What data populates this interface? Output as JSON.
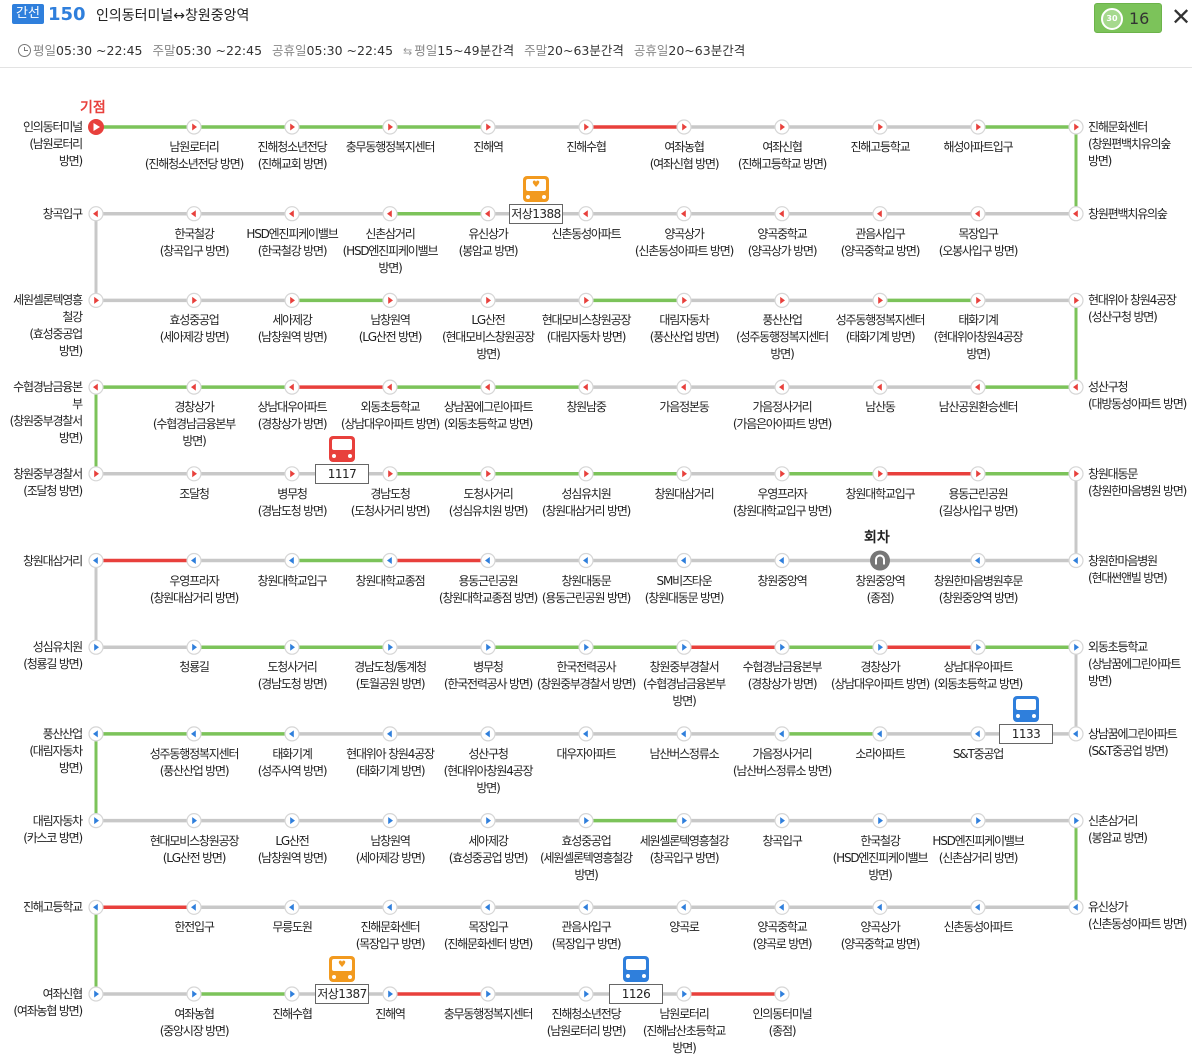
{
  "header": {
    "route_type": "간선",
    "route_number": "150",
    "route_name": "인의동터미널↔창원중앙역",
    "schedule": {
      "weekday_label": "평일",
      "weekday_time": "05:30 ~22:45",
      "weekend_label": "주말",
      "weekend_time": "05:30 ~22:45",
      "holiday_label": "공휴일",
      "holiday_time": "05:30 ~22:45",
      "weekday_interval_label": "평일",
      "weekday_interval": "15~49분간격",
      "weekend_interval_label": "주말",
      "weekend_interval": "20~63분간격",
      "holiday_interval_label": "공휴일",
      "holiday_interval": "20~63분간격"
    },
    "refresh_icon_text": "30",
    "refresh_count": "16",
    "close_icon": "close-icon"
  },
  "markers": {
    "start": "기점",
    "turn": "회차"
  },
  "colors": {
    "green": "#7cc35a",
    "red": "#e8403c",
    "gray": "#c8c8c8",
    "stop_red": "#e8403c",
    "stop_blue": "#2f7fdc",
    "turn": "#777777"
  },
  "rows": [
    {
      "dir": "right",
      "stops": [
        {
          "name": "인의동터미널",
          "sub": "(남원로터리 방면)"
        },
        {
          "name": "남원로터리",
          "sub": "(진해청소년전당 방면)"
        },
        {
          "name": "진해청소년전당",
          "sub": "(진해교회 방면)"
        },
        {
          "name": "충무동행정복지센터",
          "sub": ""
        },
        {
          "name": "진해역",
          "sub": ""
        },
        {
          "name": "진해수협",
          "sub": ""
        },
        {
          "name": "여좌농협",
          "sub": "(여좌신협 방면)"
        },
        {
          "name": "여좌신협",
          "sub": "(진해고등학교 방면)"
        },
        {
          "name": "진해고등학교",
          "sub": ""
        },
        {
          "name": "해성아파트입구",
          "sub": ""
        },
        {
          "name": "진해문화센터",
          "sub": "(창원편백치유의숲 방면)"
        }
      ],
      "segs": [
        "g",
        "g",
        "g",
        "g",
        "x",
        "r",
        "x",
        "x",
        "x",
        "g"
      ]
    },
    {
      "dir": "left",
      "stops": [
        {
          "name": "창원편백치유의숲",
          "sub": ""
        },
        {
          "name": "목장입구",
          "sub": "(오봉사입구 방면)"
        },
        {
          "name": "관음사입구",
          "sub": "(양곡중학교 방면)"
        },
        {
          "name": "양곡중학교",
          "sub": "(양곡상가 방면)"
        },
        {
          "name": "양곡상가",
          "sub": "(신촌동성아파트 방면)"
        },
        {
          "name": "신촌동성아파트",
          "sub": ""
        },
        {
          "name": "유신상가",
          "sub": "(봉암교 방면)"
        },
        {
          "name": "신촌삼거리",
          "sub": "(HSD엔진피케이밸브 방면)"
        },
        {
          "name": "HSD엔진피케이밸브",
          "sub": "(한국철강 방면)"
        },
        {
          "name": "한국철강",
          "sub": "(창곡입구 방면)"
        },
        {
          "name": "창곡입구",
          "sub": ""
        }
      ],
      "segs": [
        "x",
        "x",
        "x",
        "x",
        "x",
        "x",
        "g",
        "x",
        "x",
        "x"
      ]
    },
    {
      "dir": "right",
      "stops": [
        {
          "name": "세원셀론텍영흥철강",
          "sub": "(효성중공업 방면)"
        },
        {
          "name": "효성중공업",
          "sub": "(세아제강 방면)"
        },
        {
          "name": "세아제강",
          "sub": "(남창원역 방면)"
        },
        {
          "name": "남창원역",
          "sub": "(LG산전 방면)"
        },
        {
          "name": "LG산전",
          "sub": "(현대모비스창원공장 방면)"
        },
        {
          "name": "현대모비스창원공장",
          "sub": "(대림자동차 방면)"
        },
        {
          "name": "대림자동차",
          "sub": "(풍산산업 방면)"
        },
        {
          "name": "풍산산업",
          "sub": "(성주동행정복지센터 방면)"
        },
        {
          "name": "성주동행정복지센터",
          "sub": "(태화기계 방면)"
        },
        {
          "name": "태화기계",
          "sub": "(현대위아창원4공장 방면)"
        },
        {
          "name": "현대위아 창원4공장",
          "sub": "(성산구청 방면)"
        }
      ],
      "segs": [
        "x",
        "x",
        "g",
        "x",
        "x",
        "g",
        "x",
        "x",
        "g",
        "x"
      ]
    },
    {
      "dir": "left",
      "stops": [
        {
          "name": "성산구청",
          "sub": "(대방동성아파트 방면)"
        },
        {
          "name": "남산공원환승센터",
          "sub": ""
        },
        {
          "name": "남산동",
          "sub": ""
        },
        {
          "name": "가음정사거리",
          "sub": "(가음은아아파트 방면)"
        },
        {
          "name": "가음정본동",
          "sub": ""
        },
        {
          "name": "창원남중",
          "sub": ""
        },
        {
          "name": "상남꿈에그린아파트",
          "sub": "(외동초등학교 방면)"
        },
        {
          "name": "외동초등학교",
          "sub": "(상남대우아파트 방면)"
        },
        {
          "name": "상남대우아파트",
          "sub": "(경창상가 방면)"
        },
        {
          "name": "경창상가",
          "sub": "(수협경남금융본부 방면)"
        },
        {
          "name": "수협경남금융본부",
          "sub": "(창원중부경찰서 방면)"
        }
      ],
      "segs": [
        "g",
        "x",
        "x",
        "x",
        "x",
        "g",
        "g",
        "r",
        "g",
        "g"
      ]
    },
    {
      "dir": "right",
      "stops": [
        {
          "name": "창원중부경찰서",
          "sub": "(조달청 방면)"
        },
        {
          "name": "조달청",
          "sub": ""
        },
        {
          "name": "병무청",
          "sub": "(경남도청 방면)"
        },
        {
          "name": "경남도청",
          "sub": "(도청사거리 방면)"
        },
        {
          "name": "도청사거리",
          "sub": "(성심유치원 방면)"
        },
        {
          "name": "성심유치원",
          "sub": "(창원대삼거리 방면)"
        },
        {
          "name": "창원대삼거리",
          "sub": ""
        },
        {
          "name": "우영프라자",
          "sub": "(창원대학교입구 방면)"
        },
        {
          "name": "창원대학교입구",
          "sub": ""
        },
        {
          "name": "용동근린공원",
          "sub": "(길상사입구 방면)"
        },
        {
          "name": "창원대동문",
          "sub": "(창원한마음병원 방면)"
        }
      ],
      "segs": [
        "x",
        "x",
        "x",
        "g",
        "g",
        "g",
        "x",
        "g",
        "r",
        "g"
      ]
    },
    {
      "dir": "left",
      "stops": [
        {
          "name": "창원한마음병원",
          "sub": "(현대썬앤빌 방면)"
        },
        {
          "name": "창원한마음병원후문",
          "sub": "(창원중앙역 방면)"
        },
        {
          "name": "창원중앙역",
          "sub": "(종점)"
        },
        {
          "name": "창원중앙역",
          "sub": ""
        },
        {
          "name": "SM비즈타운",
          "sub": "(창원대동문 방면)"
        },
        {
          "name": "창원대동문",
          "sub": "(용동근린공원 방면)"
        },
        {
          "name": "용동근린공원",
          "sub": "(창원대학교종점 방면)"
        },
        {
          "name": "창원대학교종점",
          "sub": ""
        },
        {
          "name": "창원대학교입구",
          "sub": ""
        },
        {
          "name": "우영프라자",
          "sub": "(창원대삼거리 방면)"
        },
        {
          "name": "창원대삼거리",
          "sub": ""
        }
      ],
      "segs": [
        "x",
        "x",
        "x",
        "x",
        "x",
        "x",
        "r",
        "g",
        "x",
        "r"
      ]
    },
    {
      "dir": "right",
      "stops": [
        {
          "name": "성심유치원",
          "sub": "(청룡길 방면)"
        },
        {
          "name": "청룡길",
          "sub": ""
        },
        {
          "name": "도청사거리",
          "sub": "(경남도청 방면)"
        },
        {
          "name": "경남도청/통계청",
          "sub": "(토월공원 방면)"
        },
        {
          "name": "병무청",
          "sub": "(한국전력공사 방면)"
        },
        {
          "name": "한국전력공사",
          "sub": "(창원중부경찰서 방면)"
        },
        {
          "name": "창원중부경찰서",
          "sub": "(수협경남금융본부 방면)"
        },
        {
          "name": "수협경남금융본부",
          "sub": "(경창상가 방면)"
        },
        {
          "name": "경창상가",
          "sub": "(상남대우아파트 방면)"
        },
        {
          "name": "상남대우아파트",
          "sub": "(외동초등학교 방면)"
        },
        {
          "name": "외동초등학교",
          "sub": "(상남꿈에그린아파트 방면)"
        }
      ],
      "segs": [
        "x",
        "g",
        "g",
        "x",
        "g",
        "g",
        "r",
        "g",
        "r",
        "g"
      ]
    },
    {
      "dir": "left",
      "stops": [
        {
          "name": "상남꿈에그린아파트",
          "sub": "(S&T중공업 방면)"
        },
        {
          "name": "S&T중공업",
          "sub": ""
        },
        {
          "name": "소라아파트",
          "sub": ""
        },
        {
          "name": "가음정사거리",
          "sub": "(남산버스정류소 방면)"
        },
        {
          "name": "남산버스정류소",
          "sub": ""
        },
        {
          "name": "대우자아파트",
          "sub": ""
        },
        {
          "name": "성산구청",
          "sub": "(현대위아창원4공장 방면)"
        },
        {
          "name": "현대위아 창원4공장",
          "sub": "(태화기계 방면)"
        },
        {
          "name": "태화기계",
          "sub": "(성주사역 방면)"
        },
        {
          "name": "성주동행정복지센터",
          "sub": "(풍산산업 방면)"
        },
        {
          "name": "풍산산업",
          "sub": "(대림자동차 방면)"
        }
      ],
      "segs": [
        "x",
        "x",
        "g",
        "x",
        "x",
        "x",
        "x",
        "x",
        "g",
        "g"
      ]
    },
    {
      "dir": "right",
      "stops": [
        {
          "name": "대림자동차",
          "sub": "(카스코 방면)"
        },
        {
          "name": "현대모비스창원공장",
          "sub": "(LG산전 방면)"
        },
        {
          "name": "LG산전",
          "sub": "(남창원역 방면)"
        },
        {
          "name": "남창원역",
          "sub": "(세아제강 방면)"
        },
        {
          "name": "세아제강",
          "sub": "(효성중공업 방면)"
        },
        {
          "name": "효성중공업",
          "sub": "(세원셀론텍영흥철강 방면)"
        },
        {
          "name": "세원셀론텍영흥철강",
          "sub": "(창곡입구 방면)"
        },
        {
          "name": "창곡입구",
          "sub": ""
        },
        {
          "name": "한국철강",
          "sub": "(HSD엔진피케이밸브 방면)"
        },
        {
          "name": "HSD엔진피케이밸브",
          "sub": "(신촌삼거리 방면)"
        },
        {
          "name": "신촌삼거리",
          "sub": "(봉암교 방면)"
        }
      ],
      "segs": [
        "x",
        "x",
        "x",
        "x",
        "x",
        "g",
        "x",
        "x",
        "x",
        "x"
      ]
    },
    {
      "dir": "left",
      "stops": [
        {
          "name": "유신상가",
          "sub": "(신촌동성아파트 방면)"
        },
        {
          "name": "신촌동성아파트",
          "sub": ""
        },
        {
          "name": "양곡상가",
          "sub": "(양곡중학교 방면)"
        },
        {
          "name": "양곡중학교",
          "sub": "(양곡로 방면)"
        },
        {
          "name": "양곡로",
          "sub": ""
        },
        {
          "name": "관음사입구",
          "sub": "(목장입구 방면)"
        },
        {
          "name": "목장입구",
          "sub": "(진해문화센터 방면)"
        },
        {
          "name": "진해문화센터",
          "sub": "(목장입구 방면)"
        },
        {
          "name": "무릉도원",
          "sub": ""
        },
        {
          "name": "한전입구",
          "sub": ""
        },
        {
          "name": "진해고등학교",
          "sub": ""
        }
      ],
      "segs": [
        "x",
        "x",
        "x",
        "x",
        "x",
        "x",
        "x",
        "x",
        "x",
        "r"
      ]
    },
    {
      "dir": "right",
      "stops": [
        {
          "name": "여좌신협",
          "sub": "(여좌농협 방면)"
        },
        {
          "name": "여좌농협",
          "sub": "(중앙시장 방면)"
        },
        {
          "name": "진해수협",
          "sub": ""
        },
        {
          "name": "진해역",
          "sub": ""
        },
        {
          "name": "충무동행정복지센터",
          "sub": ""
        },
        {
          "name": "진해청소년전당",
          "sub": "(남원로터리 방면)"
        },
        {
          "name": "남원로터리",
          "sub": "(진해남산초등학교 방면)"
        },
        {
          "name": "인의동터미널",
          "sub": "(종점)"
        }
      ],
      "segs": [
        "x",
        "g",
        "x",
        "r",
        "x",
        "x",
        "r"
      ]
    }
  ],
  "connectors": [
    {
      "side": "right",
      "from": 0,
      "color": "g"
    },
    {
      "side": "left",
      "from": 1,
      "color": "x"
    },
    {
      "side": "right",
      "from": 2,
      "color": "g"
    },
    {
      "side": "left",
      "from": 3,
      "color": "g"
    },
    {
      "side": "right",
      "from": 4,
      "color": "x"
    },
    {
      "side": "left",
      "from": 5,
      "color": "x"
    },
    {
      "side": "right",
      "from": 6,
      "color": "x"
    },
    {
      "side": "left",
      "from": 7,
      "color": "g"
    },
    {
      "side": "right",
      "from": 8,
      "color": "g"
    },
    {
      "side": "left",
      "from": 9,
      "color": "g"
    }
  ],
  "buses": [
    {
      "row": 1,
      "stop": 6,
      "plate": "저상1388",
      "kind": "lowfloor"
    },
    {
      "row": 4,
      "stop": 3,
      "plate": "1117",
      "kind": "red"
    },
    {
      "row": 7,
      "stop": 1,
      "plate": "1133",
      "kind": "blue"
    },
    {
      "row": 10,
      "stop": 3,
      "plate": "저상1387",
      "kind": "lowfloor"
    },
    {
      "row": 10,
      "stop": 6,
      "plate": "1126",
      "kind": "blue"
    }
  ]
}
